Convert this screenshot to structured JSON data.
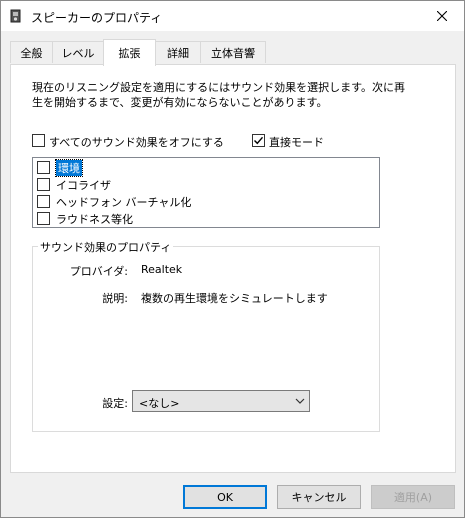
{
  "window": {
    "title": "スピーカーのプロパティ",
    "close_icon": "close-icon"
  },
  "tabs": [
    {
      "label": "全般"
    },
    {
      "label": "レベル"
    },
    {
      "label": "拡張",
      "active": true
    },
    {
      "label": "詳細"
    },
    {
      "label": "立体音響"
    }
  ],
  "enhancements": {
    "description_line1": "現在のリスニング設定を適用にするにはサウンド効果を選択します。次に再",
    "description_line2": "生を開始するまで、変更が有効にならないことがあります。",
    "disable_all": {
      "label": "すべてのサウンド効果をオフにする",
      "checked": false
    },
    "immediate_mode": {
      "label": "直接モード",
      "checked": true
    },
    "effects": [
      {
        "label": "環境",
        "checked": false,
        "selected": true
      },
      {
        "label": "イコライザ",
        "checked": false
      },
      {
        "label": "ヘッドフォン バーチャル化",
        "checked": false
      },
      {
        "label": "ラウドネス等化",
        "checked": false
      }
    ],
    "properties_group": {
      "title": "サウンド効果のプロパティ",
      "provider_label": "プロバイダ:",
      "provider_value": "Realtek",
      "description_label": "説明:",
      "description_value": "複数の再生環境をシミュレートします",
      "setting_label": "設定:",
      "setting_value": "<なし>"
    }
  },
  "buttons": {
    "ok": "OK",
    "cancel": "キャンセル",
    "apply": "適用(A)"
  }
}
